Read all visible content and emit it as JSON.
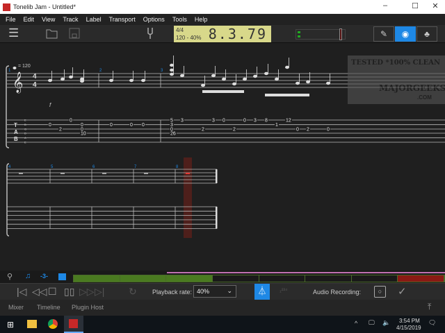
{
  "window": {
    "title": "Tonelib Jam - Untitled*",
    "minimize": "–",
    "maximize": "☐",
    "close": "✕"
  },
  "menu": [
    "File",
    "Edit",
    "View",
    "Track",
    "Label",
    "Transport",
    "Options",
    "Tools",
    "Help"
  ],
  "lcd": {
    "time_signature": "4/4",
    "tempo": "120 - 40%",
    "position": "8.3.79"
  },
  "score": {
    "tempo_mark": "= 120",
    "time_sig_top": "4",
    "time_sig_bottom": "4",
    "dynamic": "f",
    "tab_clef": [
      "T",
      "A",
      "B"
    ],
    "tuning": [
      "E",
      "B",
      "G",
      "D",
      "A",
      "E"
    ],
    "system1_bars": [
      "1",
      "2",
      "3"
    ],
    "system2_bars": [
      "4",
      "5",
      "6",
      "7",
      "8"
    ],
    "tab_notes": [
      {
        "s": 2,
        "f": "0"
      },
      {
        "s": 3,
        "f": "2"
      },
      {
        "s": 1,
        "f": "0"
      },
      {
        "s": 2,
        "f": "0"
      },
      {
        "s": 3,
        "f": "0"
      },
      {
        "s": 4,
        "f": "10"
      },
      {
        "s": 2,
        "f": "0"
      },
      {
        "s": 2,
        "f": "0"
      },
      {
        "s": 2,
        "f": "0"
      },
      {
        "s": 1,
        "f": "5"
      },
      {
        "s": 2,
        "f": "3"
      },
      {
        "s": 3,
        "f": "0"
      },
      {
        "s": 4,
        "f": "26"
      },
      {
        "s": 1,
        "f": "3"
      },
      {
        "s": 3,
        "f": "2"
      },
      {
        "s": 1,
        "f": "3"
      },
      {
        "s": 1,
        "f": "0"
      },
      {
        "s": 3,
        "f": "2"
      },
      {
        "s": 1,
        "f": "0"
      },
      {
        "s": 1,
        "f": "3"
      },
      {
        "s": 1,
        "f": "8"
      },
      {
        "s": 2,
        "f": "1"
      },
      {
        "s": 1,
        "f": "12"
      },
      {
        "s": 3,
        "f": "0"
      },
      {
        "s": 3,
        "f": "2"
      },
      {
        "s": 3,
        "f": "0"
      }
    ],
    "watermark": "TESTED *100% CLEAN MAJORGEEKS .COM"
  },
  "transport": {
    "playback_rate_label": "Playback rate:",
    "playback_rate": "40%",
    "audio_recording_label": "Audio Recording:"
  },
  "bottom_tabs": [
    "Mixer",
    "Timeline",
    "Plugin Host"
  ],
  "taskbar": {
    "time": "3:54 PM",
    "date": "4/15/2019"
  },
  "colors": {
    "accent": "#1e88e5",
    "lcd": "#d8d88a",
    "track_green": "#4a7a20",
    "track_red": "#8a1a14",
    "playhead": "#5a1f1a"
  }
}
